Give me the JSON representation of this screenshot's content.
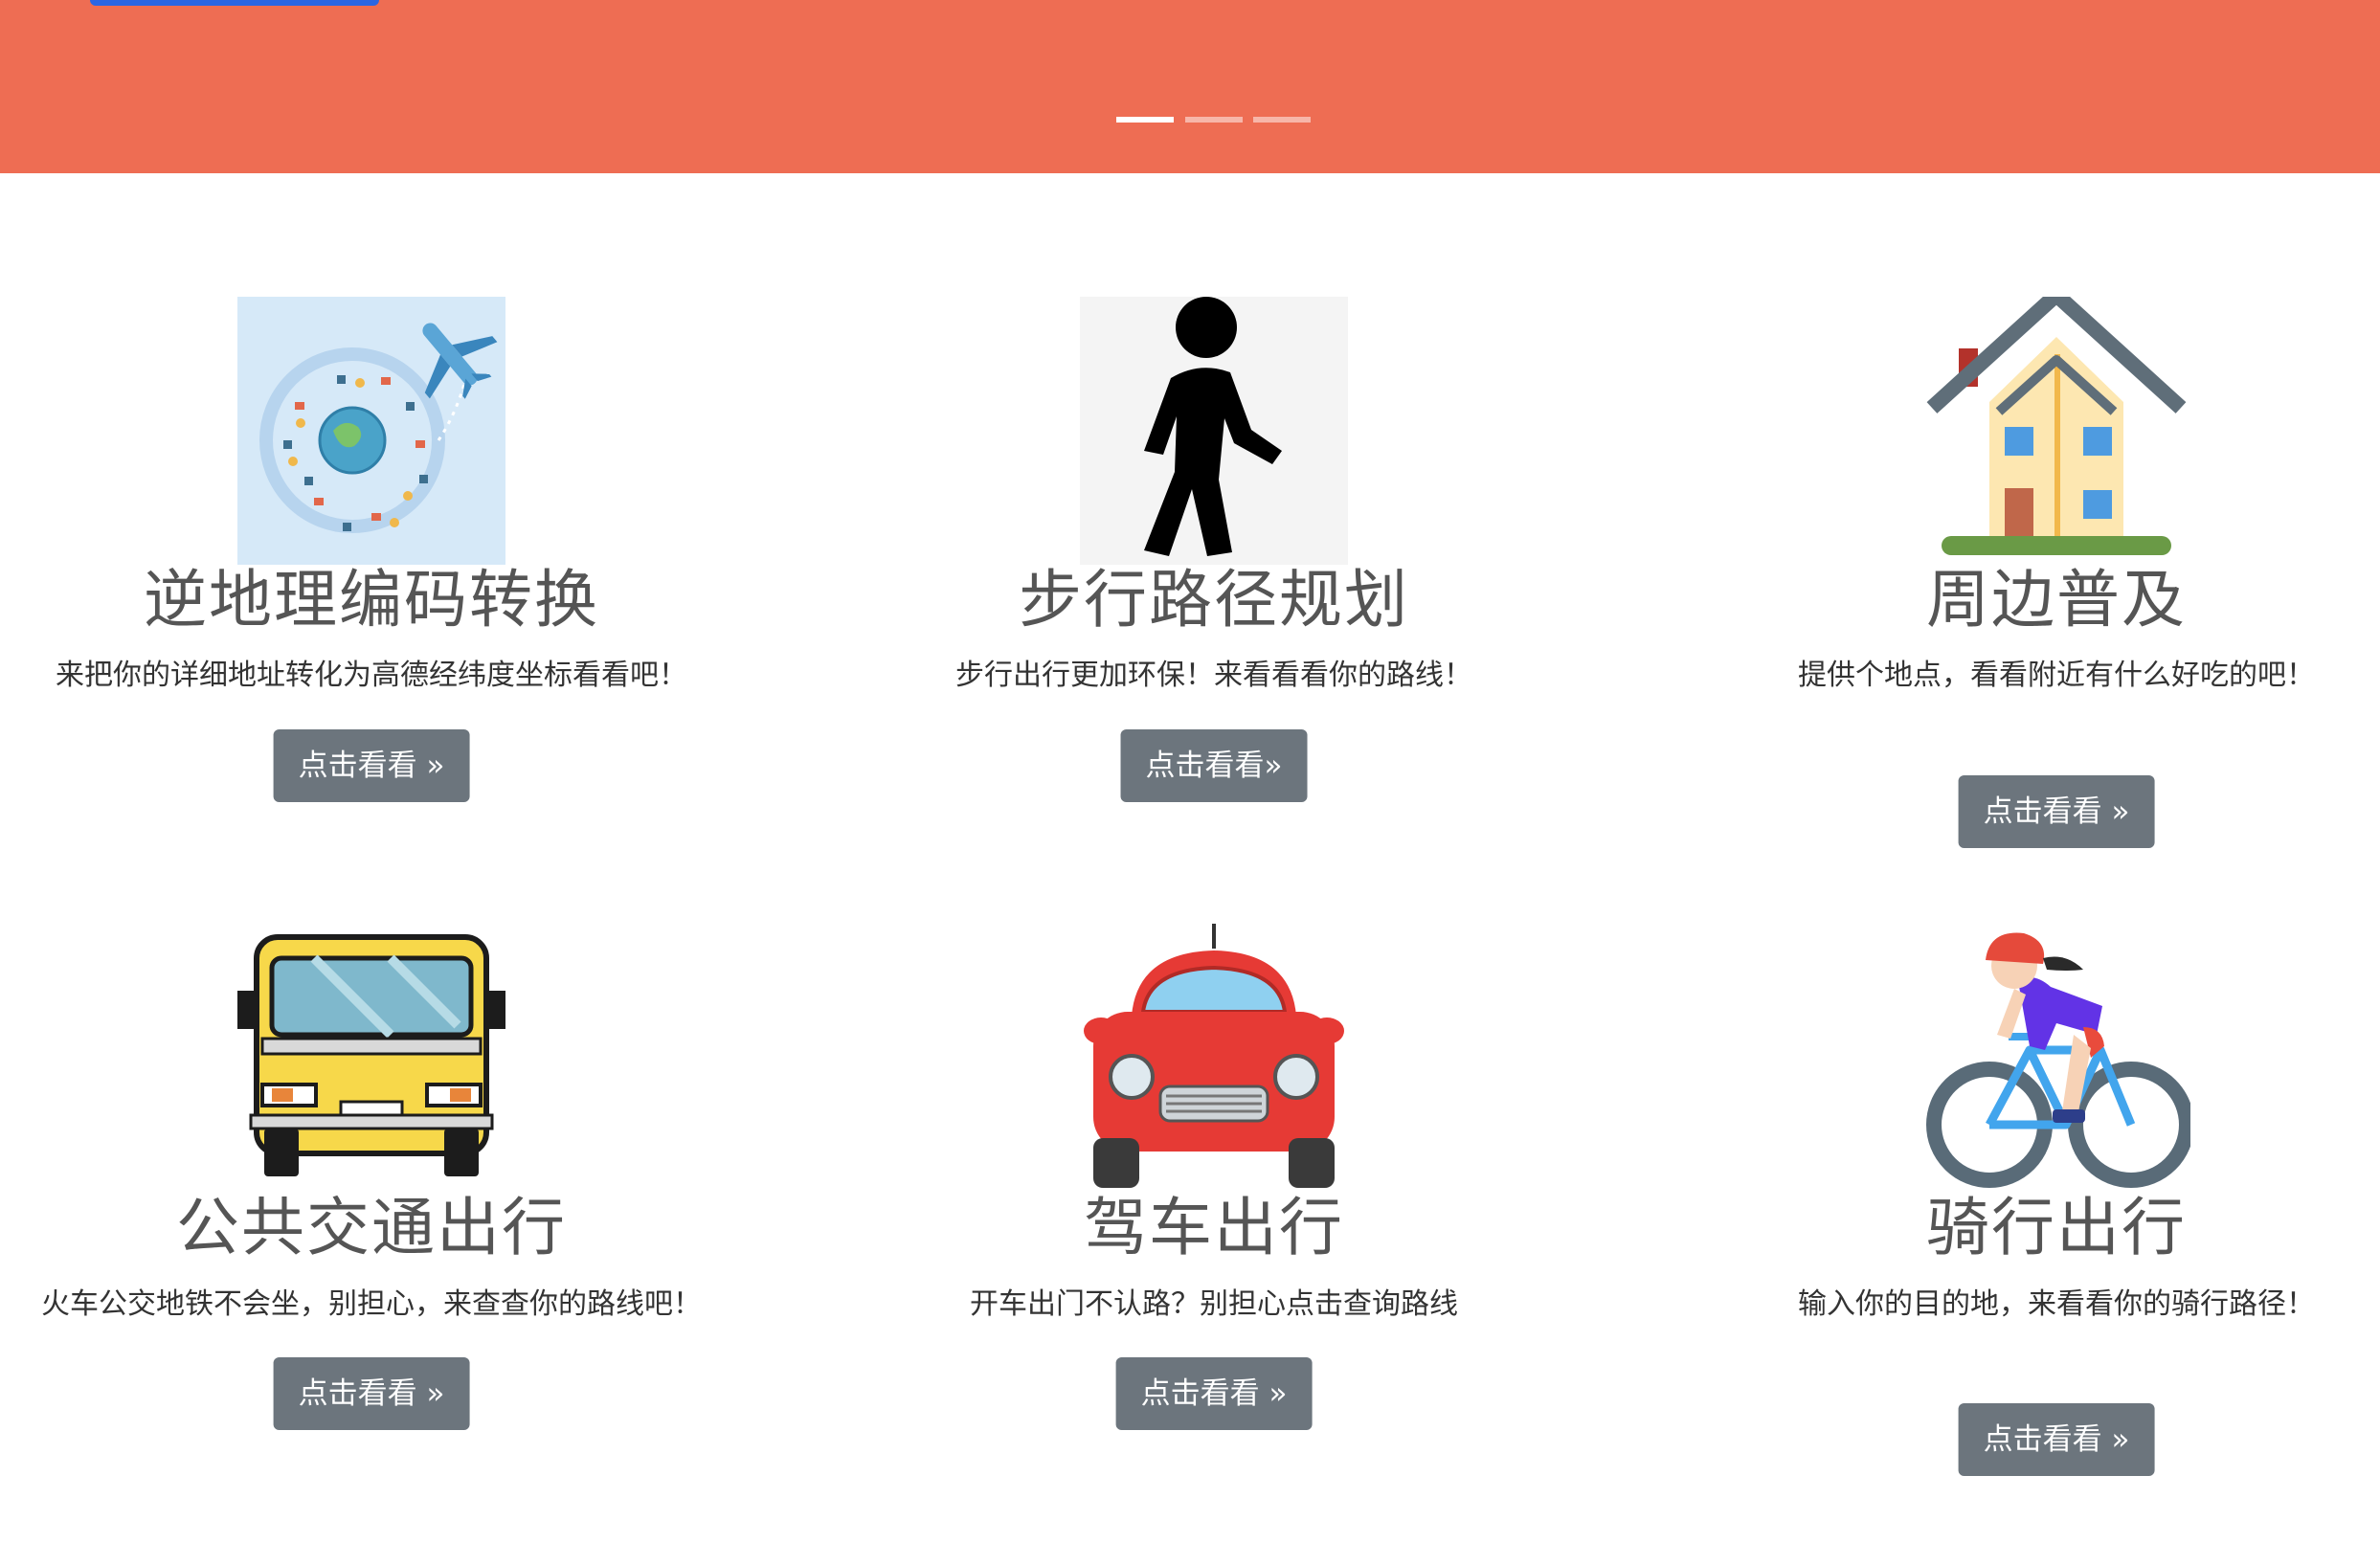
{
  "hero": {
    "carousel_indicators": [
      "active",
      "inactive",
      "inactive"
    ]
  },
  "cards": [
    {
      "icon": "globe-plane-icon",
      "title": "逆地理编码转换",
      "desc": "来把你的详细地址转化为高德经纬度坐标看看吧！",
      "button": "点击看看 »"
    },
    {
      "icon": "walking-person-icon",
      "title": "步行路径规划",
      "desc": "步行出行更加环保！来看看看你的路线！",
      "button": "点击看看»"
    },
    {
      "icon": "house-icon",
      "title": "周边普及",
      "desc": "提供个地点，看看附近有什么好吃的吧！",
      "button": "点击看看 »"
    },
    {
      "icon": "bus-icon",
      "title": "公共交通出行",
      "desc": "火车公交地铁不会坐，别担心，来查查你的路线吧！",
      "button": "点击看看 »"
    },
    {
      "icon": "car-icon",
      "title": "驾车出行",
      "desc": "开车出门不认路？别担心点击查询路线",
      "button": "点击看看 »"
    },
    {
      "icon": "cyclist-icon",
      "title": "骑行出行",
      "desc": "输入你的目的地，来看看你的骑行路径！",
      "button": "点击看看 »"
    }
  ],
  "colors": {
    "hero_bg": "#ee6d53",
    "button_bg": "#6c757d",
    "button_text": "#ffffff",
    "title_text": "#555555"
  }
}
